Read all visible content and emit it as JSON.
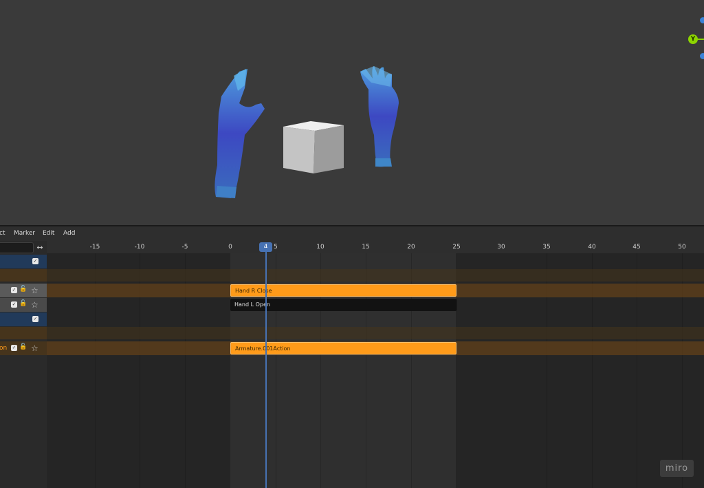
{
  "viewport": {
    "gizmo_y_label": "Y"
  },
  "menu": [
    "ct",
    "Marker",
    "Edit",
    "Add"
  ],
  "toolbar": {
    "swap_icon": "double-arrow-icon"
  },
  "ruler": {
    "ticks": [
      "-15",
      "-10",
      "-5",
      "0",
      "5",
      "10",
      "15",
      "20",
      "25",
      "30",
      "35",
      "40",
      "45",
      "50"
    ],
    "current_frame": "4"
  },
  "tracks": {
    "strip_hand_r": "Hand R Close",
    "strip_hand_l": "Hand L Open",
    "channel_armature_label": "on",
    "strip_armature": "Armature.001Action"
  },
  "watermark": "miro",
  "colors": {
    "strip_active": "#ff9b1a",
    "playhead": "#4772b3",
    "object_row": "#213a5a",
    "action_row": "#46341c"
  }
}
